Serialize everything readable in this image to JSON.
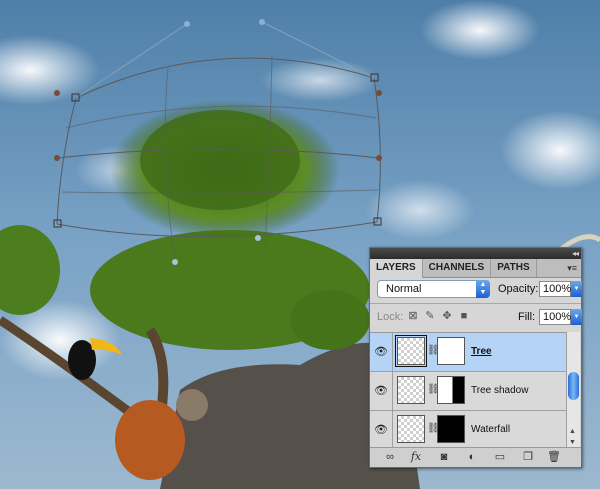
{
  "panel": {
    "tabs": [
      "LAYERS",
      "CHANNELS",
      "PATHS"
    ],
    "active_tab": "LAYERS",
    "blend_mode": "Normal",
    "opacity_label": "Opacity:",
    "opacity_value": "100%",
    "lock_label": "Lock:",
    "fill_label": "Fill:",
    "fill_value": "100%",
    "layers": [
      {
        "name": "Tree",
        "selected": true,
        "mask": "mostly-white",
        "visible": true
      },
      {
        "name": "Tree shadow",
        "selected": false,
        "mask": "half",
        "visible": true
      },
      {
        "name": "Waterfall",
        "selected": false,
        "mask": "black",
        "visible": true
      }
    ],
    "bottom_icons": [
      "link-layers-icon",
      "fx-icon",
      "add-mask-icon",
      "adjustment-layer-icon",
      "new-group-icon",
      "new-layer-icon",
      "trash-icon"
    ],
    "accent_color": "#b5d3f5"
  }
}
